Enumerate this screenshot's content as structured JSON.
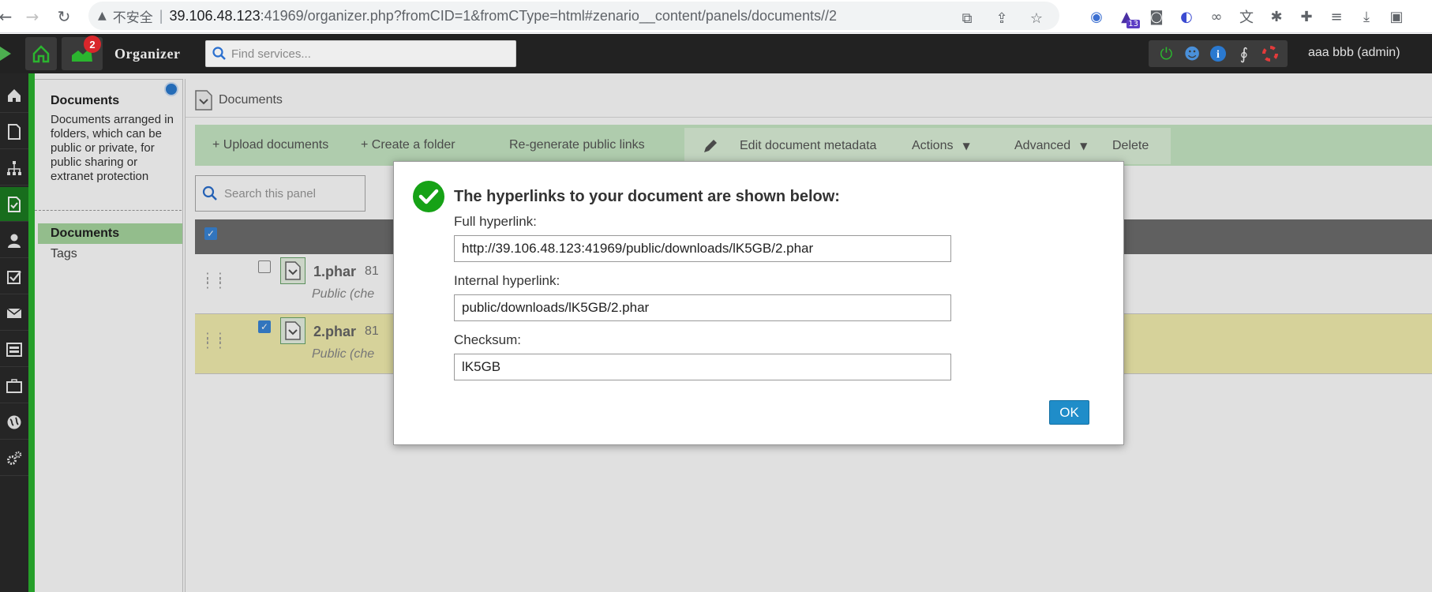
{
  "browser": {
    "insecure_label": "不安全",
    "url_host": "39.106.48.123",
    "url_path": ":41969/organizer.php?fromCID=1&fromCType=html#zenario__content/panels/documents//2",
    "extension_badge": "13"
  },
  "header": {
    "app_title": "Organizer",
    "notification_count": "2",
    "search_placeholder": "Find services...",
    "user": "aaa bbb (admin)"
  },
  "left_panel": {
    "title": "Documents",
    "description": "Documents arranged in folders, which can be public or private, for public sharing or extranet protection",
    "nav_active": "Documents",
    "nav_tags": "Tags"
  },
  "main": {
    "breadcrumb": "Documents",
    "toolbar": {
      "upload": "+ Upload documents",
      "create_folder": "+ Create a folder",
      "regenerate": "Re-generate public links",
      "edit_metadata": "Edit document metadata",
      "actions": "Actions",
      "advanced": "Advanced",
      "delete": "Delete"
    },
    "search_placeholder": "Search this panel",
    "rows": [
      {
        "name": "1.phar",
        "size": "81",
        "sub": "Public   (che",
        "checked": false
      },
      {
        "name": "2.phar",
        "size": "81",
        "sub": "Public   (che",
        "checked": true
      }
    ]
  },
  "dialog": {
    "title": "The hyperlinks to your document are shown below:",
    "full_label": "Full hyperlink:",
    "full_value": "http://39.106.48.123:41969/public/downloads/lK5GB/2.phar",
    "internal_label": "Internal hyperlink:",
    "internal_value": "public/downloads/lK5GB/2.phar",
    "checksum_label": "Checksum:",
    "checksum_value": "lK5GB",
    "ok_label": "OK"
  },
  "colors": {
    "accent_green": "#2bb52f",
    "ok_blue": "#1f8dc9",
    "selected_row": "#f4f0b0"
  }
}
